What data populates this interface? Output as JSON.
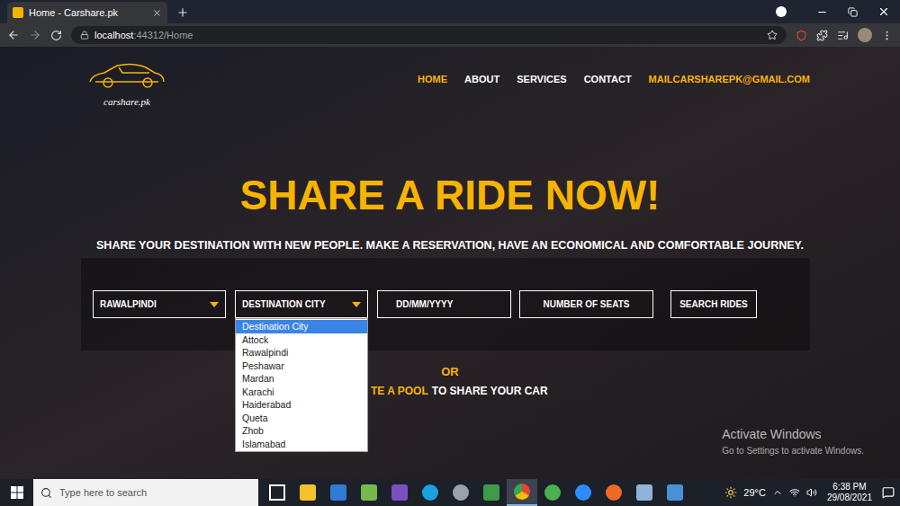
{
  "window": {
    "title": "Home - Carshare.pk"
  },
  "address": {
    "host": "localhost",
    "path": ":44312/Home"
  },
  "page": {
    "logo": "carshare.pk",
    "nav": [
      {
        "label": "HOME",
        "selected": true
      },
      {
        "label": "ABOUT",
        "selected": false
      },
      {
        "label": "SERVICES",
        "selected": false
      },
      {
        "label": "CONTACT",
        "selected": false
      }
    ],
    "contact_email": "MAILCARSHAREPK@GMAIL.COM",
    "hero": {
      "title": "SHARE A RIDE NOW!",
      "subtitle": "SHARE YOUR DESTINATION WITH NEW PEOPLE. MAKE A RESERVATION, HAVE AN ECONOMICAL AND COMFORTABLE JOURNEY."
    },
    "search": {
      "origin": "RAWALPINDI",
      "destination": {
        "value": "DESTINATION CITY",
        "expanded": true,
        "options": [
          {
            "label": "Destination City",
            "selected": true
          },
          {
            "label": "Attock",
            "selected": false
          },
          {
            "label": "Rawalpindi",
            "selected": false
          },
          {
            "label": "Peshawar",
            "selected": false
          },
          {
            "label": "Mardan",
            "selected": false
          },
          {
            "label": "Karachi",
            "selected": false
          },
          {
            "label": "Haiderabad",
            "selected": false
          },
          {
            "label": "Queta",
            "selected": false
          },
          {
            "label": "Zhob",
            "selected": false
          },
          {
            "label": "Islamabad",
            "selected": false
          }
        ]
      },
      "date_placeholder": "DD/MM/YYYY",
      "seats_placeholder": "NUMBER OF SEATS",
      "button": "SEARCH RIDES"
    },
    "or": "OR",
    "pool": {
      "link": "TE A POOL",
      "text": "TO SHARE YOUR CAR"
    }
  },
  "watermark": {
    "title": "Activate Windows",
    "text": "Go to Settings to activate Windows."
  },
  "taskbar": {
    "search_placeholder": "Type here to search",
    "apps": [
      {
        "kind": "taskview",
        "selected": false
      },
      {
        "kind": "explorer",
        "selected": false
      },
      {
        "kind": "blue",
        "selected": false
      },
      {
        "kind": "notepad",
        "selected": false
      },
      {
        "kind": "vs",
        "selected": false
      },
      {
        "kind": "skype",
        "selected": false
      },
      {
        "kind": "gray",
        "selected": false
      },
      {
        "kind": "excel",
        "selected": false
      },
      {
        "kind": "chrome",
        "selected": true
      },
      {
        "kind": "green",
        "selected": false
      },
      {
        "kind": "zoom",
        "selected": false
      },
      {
        "kind": "orange",
        "selected": false
      },
      {
        "kind": "files",
        "selected": false
      },
      {
        "kind": "camera",
        "selected": false
      }
    ],
    "weather": "29°C",
    "time": "6:38 PM",
    "date": "29/08/2021"
  }
}
